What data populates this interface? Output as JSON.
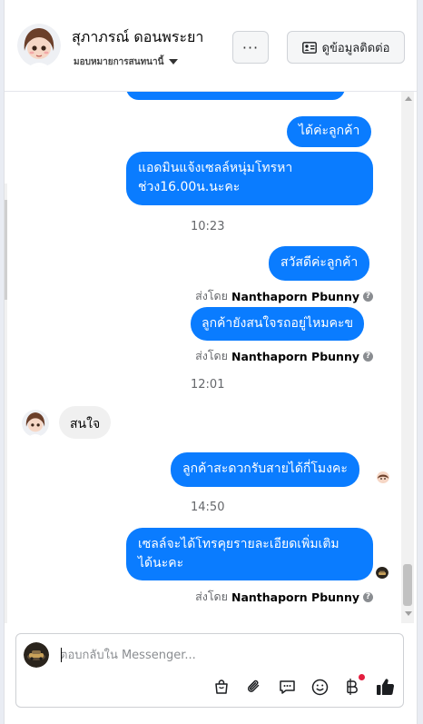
{
  "header": {
    "customer_name": "สุภาภรณ์ ดอนพระยา",
    "assign_label": "มอบหมายการสนทนานี้",
    "more_label": "···",
    "contact_button_label": "ดูข้อมูลติดต่อ"
  },
  "thread": {
    "msg_confirm": "ได้ค่ะลูกค้า",
    "msg_admin_notice_line1": "แอดมินแจ้งเซลล์หนุ่มโทรหา",
    "msg_admin_notice_line2": "ช่วง16.00น.นะคะ",
    "time_1": "10:23",
    "msg_hello": "สวัสดีค่ะลูกค้า",
    "sent_by_prefix": "ส่งโดย",
    "sender_name": "Nanthaporn Pbunny",
    "msg_still_interested": "ลูกค้ายังสนใจรถอยู่ไหมคะข",
    "time_2": "12:01",
    "msg_customer_interested": "สนใจ",
    "msg_convenient_time": "ลูกค้าสะดวกรับสายได้กี่โมงคะ",
    "time_3": "14:50",
    "msg_sales_call_line1": "เซลล์จะได้โทรคุยรายละเอียดเพิ่มเติม",
    "msg_sales_call_line2": "ได้นะคะ",
    "info_icon_glyph": "?"
  },
  "composer": {
    "placeholder": "ตอบกลับใน Messenger..."
  },
  "colors": {
    "outgoing_bubble": "#0a7cff",
    "incoming_bubble": "#f0f0f0",
    "like_icon": "#1c1e21",
    "notification_dot": "#e41e3f"
  },
  "icons": [
    "more-icon",
    "contact-card-icon",
    "caret-down-icon",
    "info-icon",
    "shopping-bag-icon",
    "attachment-icon",
    "comment-bubble-icon",
    "emoji-icon",
    "baht-icon",
    "thumbs-up-icon"
  ]
}
